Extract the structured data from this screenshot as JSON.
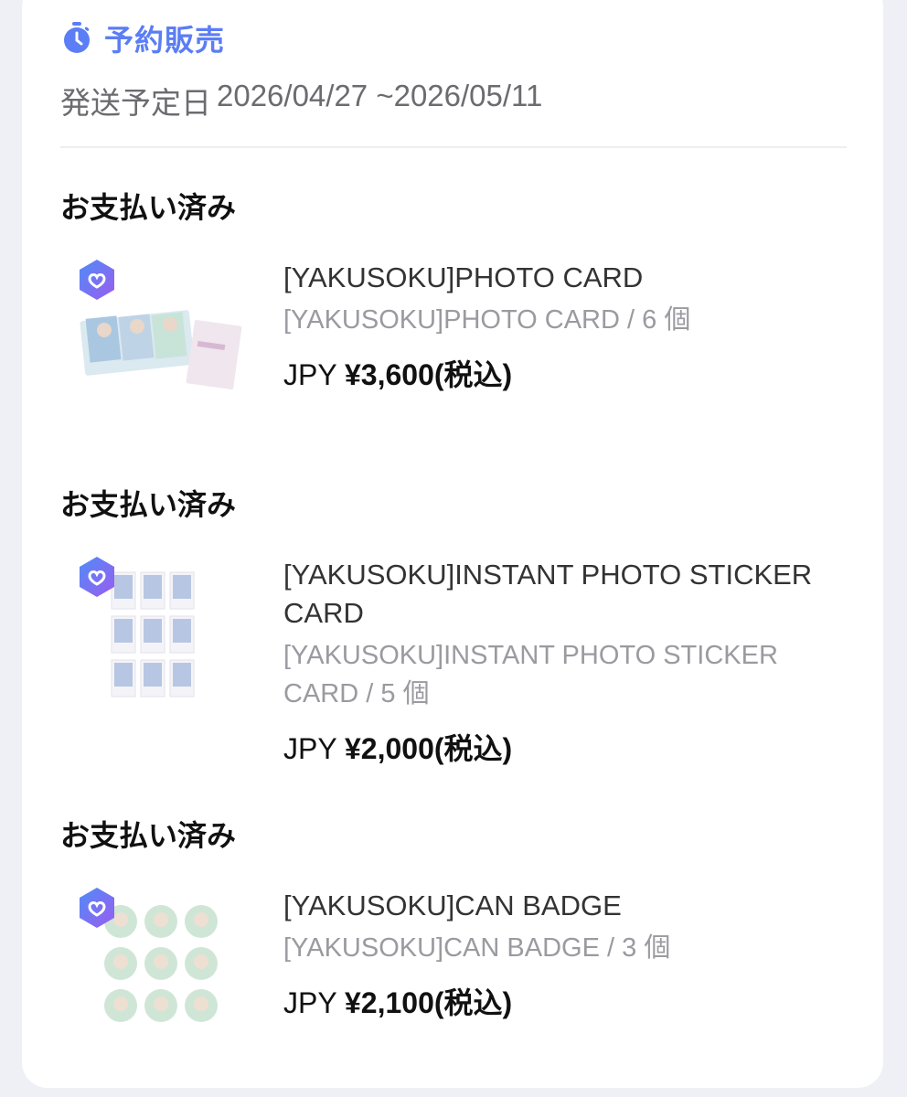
{
  "header": {
    "sale_type": "予約販売",
    "ship_label": "発送予定日",
    "ship_range": "2026/04/27 ~2026/05/11",
    "accent_color": "#5b7df5"
  },
  "orders": [
    {
      "status": "お支払い済み",
      "name": "[YAKUSOKU]PHOTO CARD",
      "sub_name": "[YAKUSOKU]PHOTO CARD",
      "quantity": "6",
      "quantity_unit": "個",
      "currency": "JPY",
      "price": "¥3,600(税込)",
      "thumbnail_icon": "photo-card-set-image"
    },
    {
      "status": "お支払い済み",
      "name": "[YAKUSOKU]INSTANT PHOTO STICKER CARD",
      "sub_name": "[YAKUSOKU]INSTANT PHOTO STICKER CARD",
      "quantity": "5",
      "quantity_unit": "個",
      "currency": "JPY",
      "price": "¥2,000(税込)",
      "thumbnail_icon": "sticker-card-grid-image"
    },
    {
      "status": "お支払い済み",
      "name": "[YAKUSOKU]CAN BADGE",
      "sub_name": "[YAKUSOKU]CAN BADGE",
      "quantity": "3",
      "quantity_unit": "個",
      "currency": "JPY",
      "price": "¥2,100(税込)",
      "thumbnail_icon": "can-badge-grid-image"
    }
  ],
  "icons": {
    "clock": "stopwatch-icon",
    "badge": "verified-heart-badge-icon"
  }
}
